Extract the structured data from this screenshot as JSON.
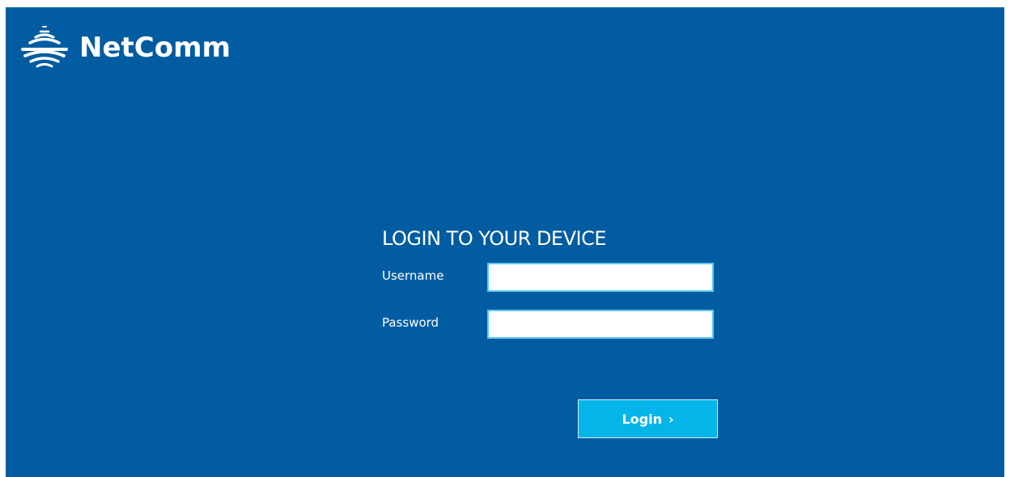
{
  "brand": {
    "name": "NetComm",
    "icon": "wifi-signal-icon",
    "background_color": "#015ca1",
    "accent_color": "#05b5e9"
  },
  "login": {
    "title": "LOGIN TO YOUR DEVICE",
    "username_label": "Username",
    "username_value": "",
    "password_label": "Password",
    "password_value": "",
    "button_label": "Login",
    "button_icon": "chevron-right-icon",
    "button_glyph": "›"
  }
}
